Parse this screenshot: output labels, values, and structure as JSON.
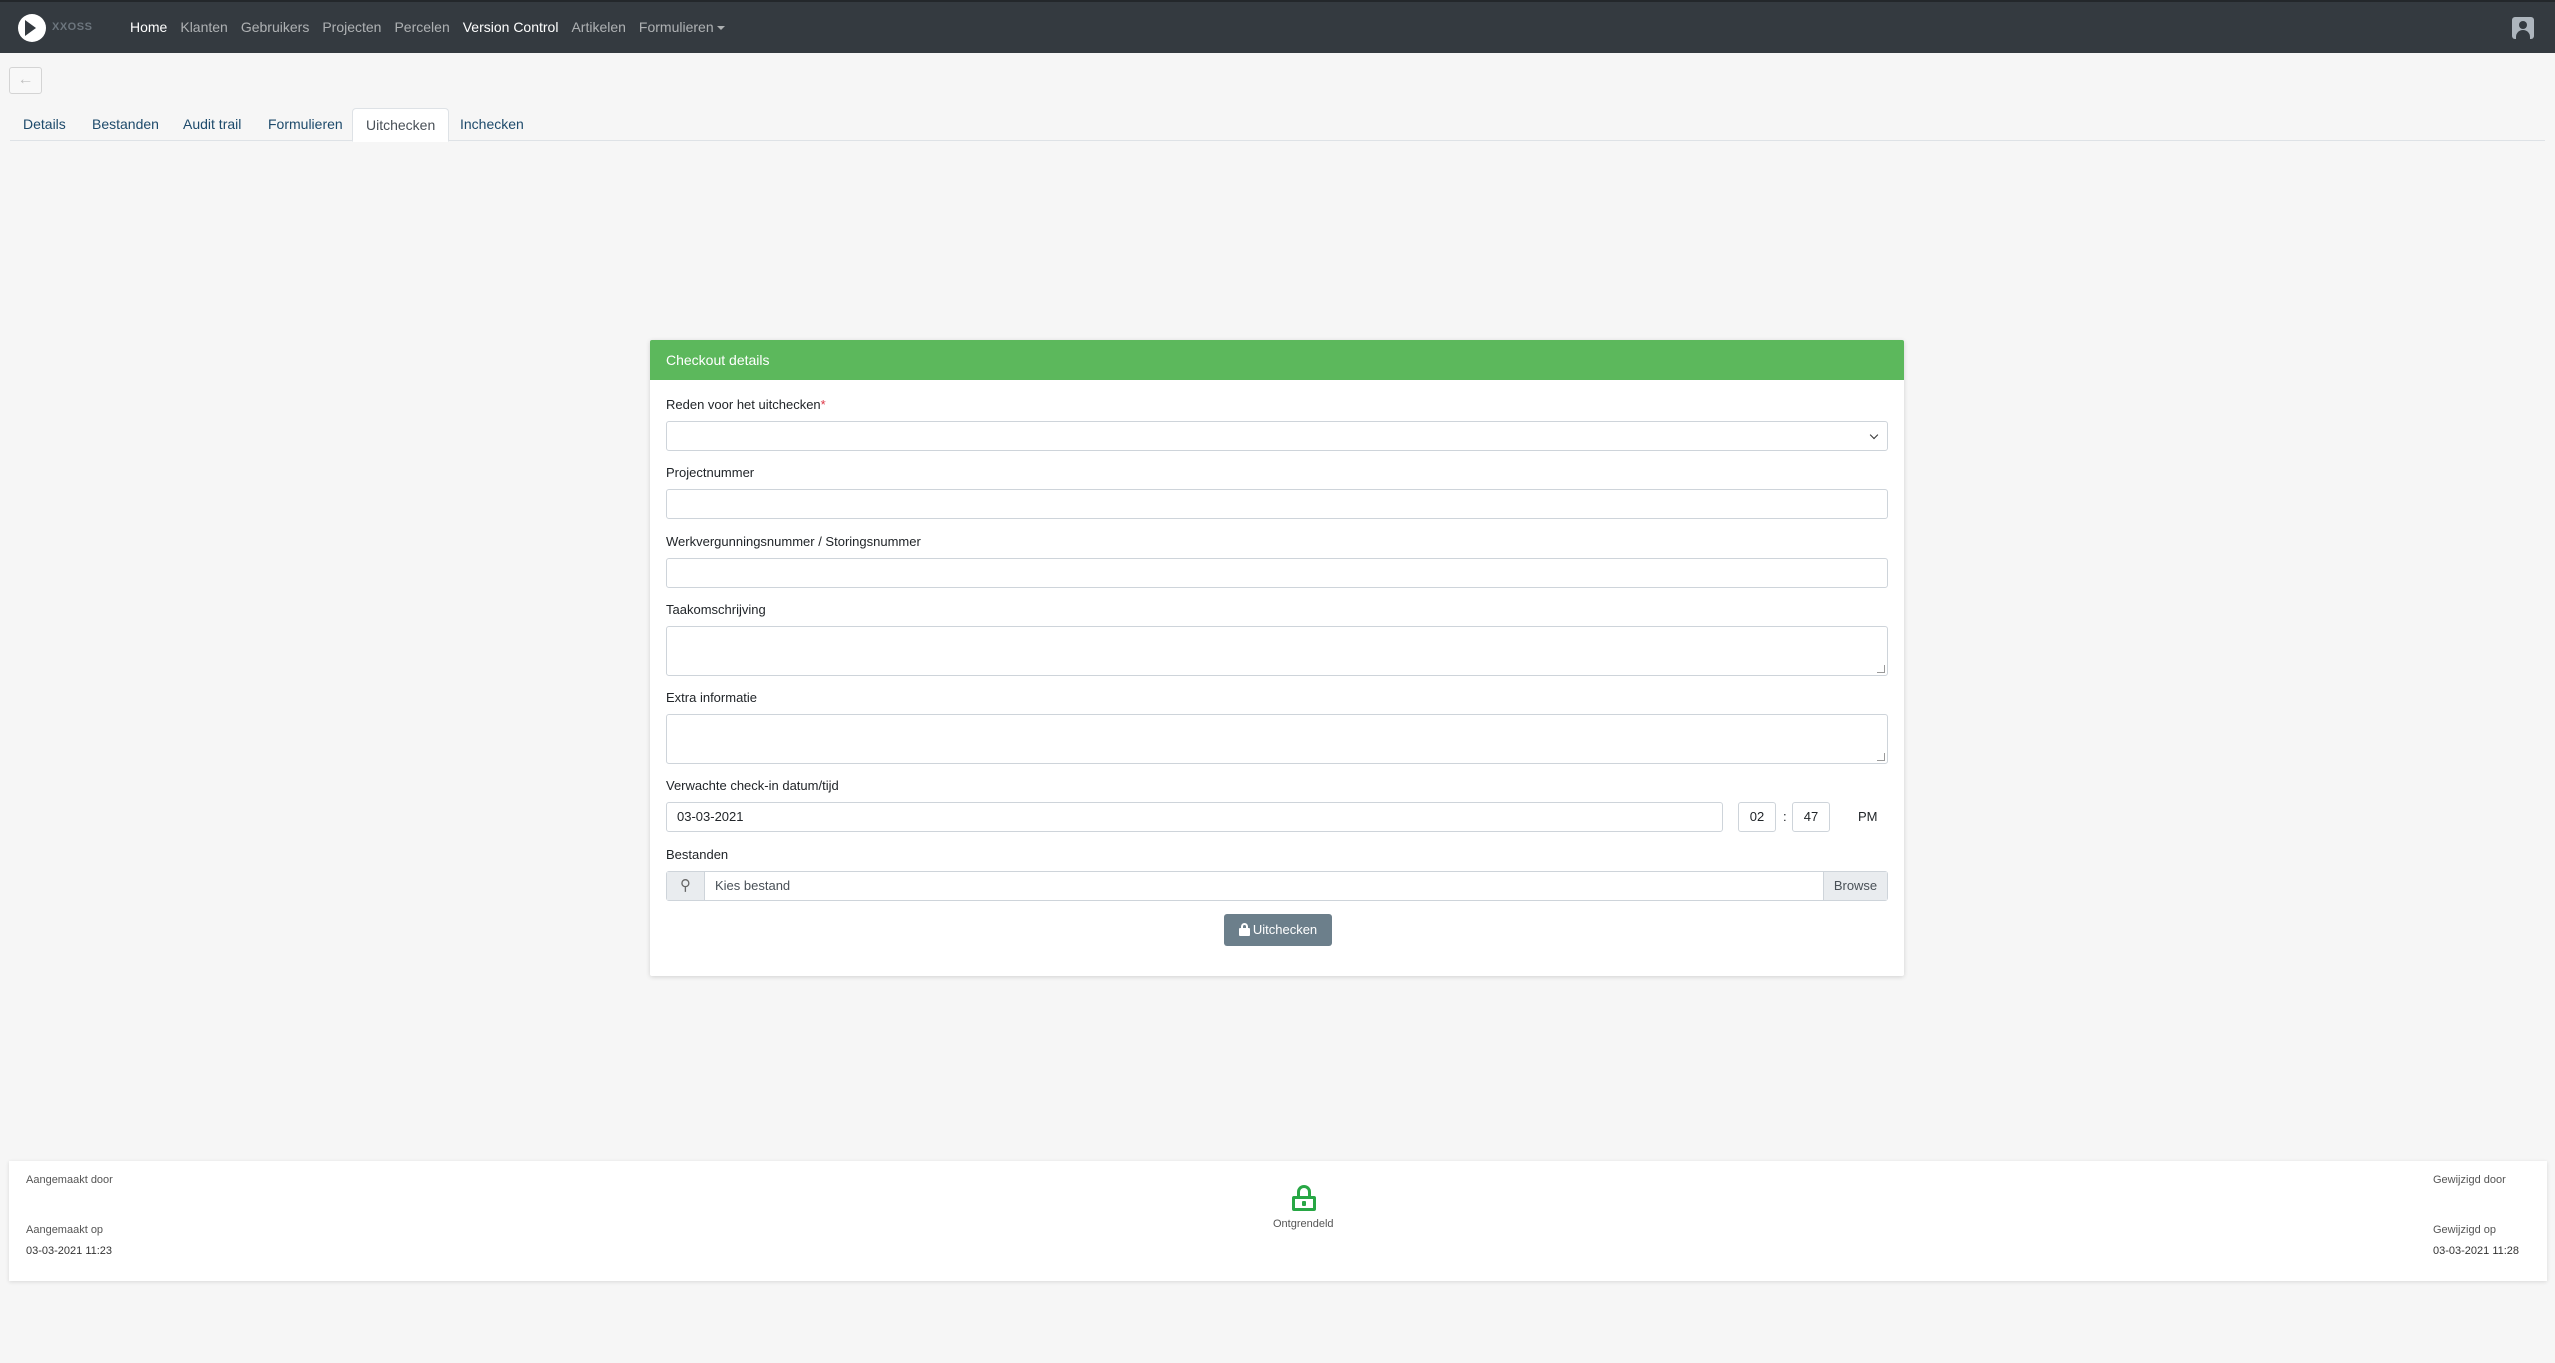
{
  "navbar": {
    "brand": "XXOSS",
    "links": [
      "Home",
      "Klanten",
      "Gebruikers",
      "Projecten",
      "Percelen",
      "Version Control",
      "Artikelen",
      "Formulieren"
    ]
  },
  "back": {
    "icon": "←"
  },
  "tabs": [
    "Details",
    "Bestanden",
    "Audit trail",
    "Formulieren",
    "Uitchecken",
    "Inchecken"
  ],
  "form": {
    "header": "Checkout details",
    "reason_label": "Reden voor het uitchecken",
    "required_mark": "*",
    "reason_value": "",
    "project_label": "Projectnummer",
    "project_value": "",
    "permit_label": "Werkvergunningsnummer / Storingsnummer",
    "permit_value": "",
    "task_label": "Taakomschrijving",
    "task_value": "",
    "extra_label": "Extra informatie",
    "extra_value": "",
    "checkin_label": "Verwachte check-in datum/tijd",
    "checkin_date": "03-03-2021",
    "checkin_hour": "02",
    "time_separator": ":",
    "checkin_minute": "47",
    "checkin_ampm": "PM",
    "files_label": "Bestanden",
    "file_placeholder": "Kies bestand",
    "browse_label": "Browse",
    "submit_label": "Uitchecken"
  },
  "footer": {
    "created_by_label": "Aangemaakt door",
    "created_by_value": "",
    "created_on_label": "Aangemaakt op",
    "created_on_value": "03-03-2021 11:23",
    "lock_status": "Ontgrendeld",
    "modified_by_label": "Gewijzigd door",
    "modified_by_value": "",
    "modified_on_label": "Gewijzigd op",
    "modified_on_value": "03-03-2021 11:28"
  },
  "colors": {
    "navbar": "#343a40",
    "card_header": "#5cb85c",
    "submit_button": "#6c7f8b",
    "unlock_icon": "#28a745"
  }
}
